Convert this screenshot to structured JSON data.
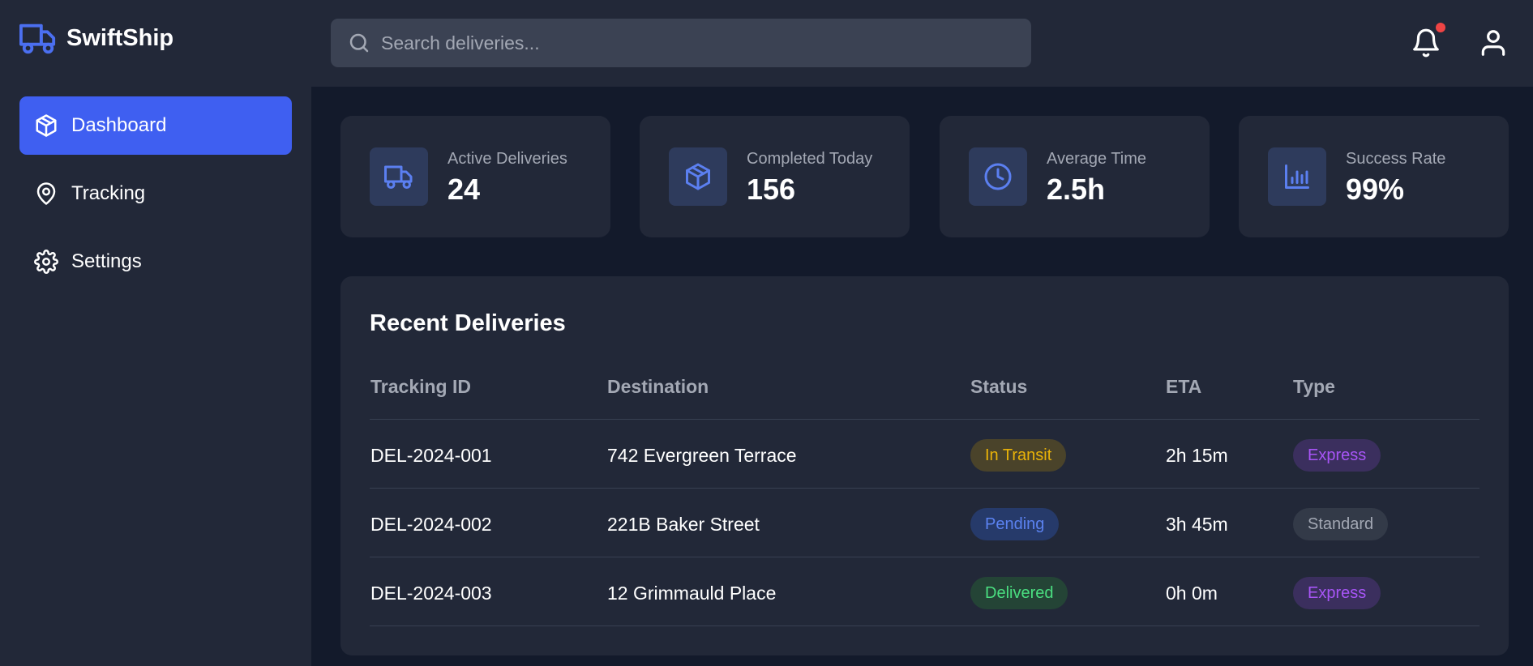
{
  "brand": {
    "name": "SwiftShip",
    "logo_icon": "truck-icon",
    "accent": "#4b6ff0"
  },
  "search": {
    "placeholder": "Search deliveries...",
    "value": ""
  },
  "header": {
    "notification_icon": "bell-icon",
    "notification_dot_color": "#ef4444",
    "user_icon": "user-icon"
  },
  "sidebar": {
    "items": [
      {
        "label": "Dashboard",
        "icon": "package-icon",
        "active": true
      },
      {
        "label": "Tracking",
        "icon": "map-pin-icon",
        "active": false
      },
      {
        "label": "Settings",
        "icon": "gear-icon",
        "active": false
      }
    ]
  },
  "stats": [
    {
      "label": "Active Deliveries",
      "value": "24",
      "icon": "truck-icon"
    },
    {
      "label": "Completed Today",
      "value": "156",
      "icon": "package-icon"
    },
    {
      "label": "Average Time",
      "value": "2.5h",
      "icon": "clock-icon"
    },
    {
      "label": "Success Rate",
      "value": "99%",
      "icon": "bar-chart-icon"
    }
  ],
  "table": {
    "title": "Recent Deliveries",
    "columns": [
      "Tracking ID",
      "Destination",
      "Status",
      "ETA",
      "Type"
    ],
    "rows": [
      {
        "id": "DEL-2024-001",
        "destination": "742 Evergreen Terrace",
        "status": "In Transit",
        "eta": "2h 15m",
        "type": "Express"
      },
      {
        "id": "DEL-2024-002",
        "destination": "221B Baker Street",
        "status": "Pending",
        "eta": "3h 45m",
        "type": "Standard"
      },
      {
        "id": "DEL-2024-003",
        "destination": "12 Grimmauld Place",
        "status": "Delivered",
        "eta": "0h 0m",
        "type": "Express"
      }
    ]
  },
  "colors": {
    "header_bg": "#222838",
    "page_bg": "#131a2b",
    "active_nav": "#3f5ff1",
    "status_in_transit": {
      "bg": "#4a432a",
      "fg": "#eab308"
    },
    "status_pending": {
      "bg": "#263a6a",
      "fg": "#5b82f0"
    },
    "status_delivered": {
      "bg": "#244436",
      "fg": "#4ade80"
    },
    "type_express": {
      "bg": "#3b2f5e",
      "fg": "#a855f7"
    },
    "type_standard": {
      "bg": "#333a48",
      "fg": "#a3a8b4"
    }
  }
}
